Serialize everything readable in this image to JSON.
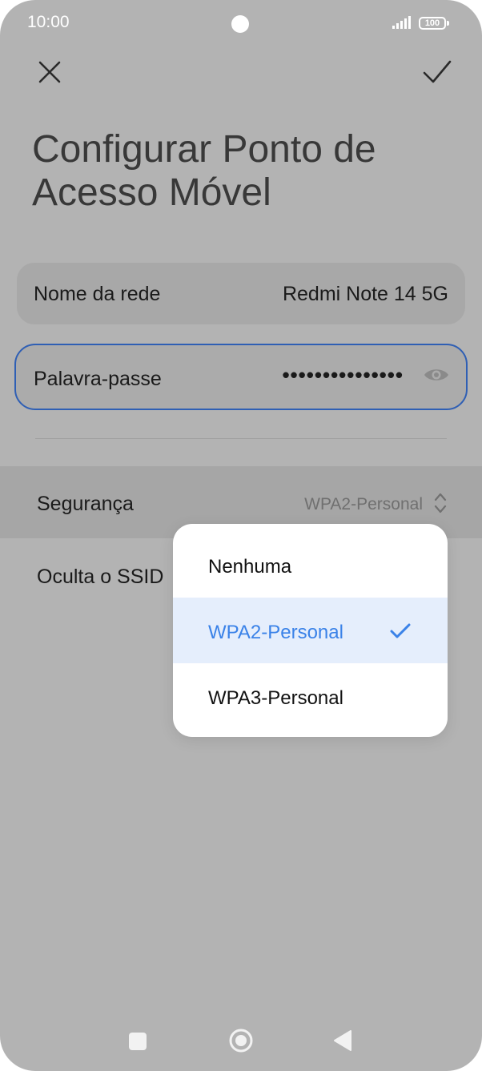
{
  "status_bar": {
    "time": "10:00",
    "battery": "100",
    "icons": [
      "signal-icon",
      "battery-icon"
    ]
  },
  "toolbar": {
    "close_icon": "close-icon",
    "confirm_icon": "checkmark-icon"
  },
  "page": {
    "title": "Configurar Ponto de Acesso Móvel"
  },
  "network_name": {
    "label": "Nome da rede",
    "value": "Redmi Note 14 5G"
  },
  "password": {
    "label": "Palavra-passe",
    "value": "•••••••••••••••",
    "toggle_icon": "eye-icon"
  },
  "security": {
    "label": "Segurança",
    "value": "WPA2-Personal",
    "icon": "chevron-up-down-icon"
  },
  "hide_ssid": {
    "label": "Oculta o SSID"
  },
  "dropdown": {
    "options": [
      {
        "label": "Nenhuma",
        "selected": false
      },
      {
        "label": "WPA2-Personal",
        "selected": true
      },
      {
        "label": "WPA3-Personal",
        "selected": false
      }
    ],
    "selected_icon": "checkmark-icon"
  },
  "nav_bar": {
    "icons": [
      "recents-square-icon",
      "home-circle-icon",
      "back-triangle-icon"
    ]
  },
  "colors": {
    "accent": "#3a82e8",
    "focus_border": "#2f5fb4",
    "scrim": "#b3b3b3",
    "selected_bg": "#e5eefc"
  }
}
